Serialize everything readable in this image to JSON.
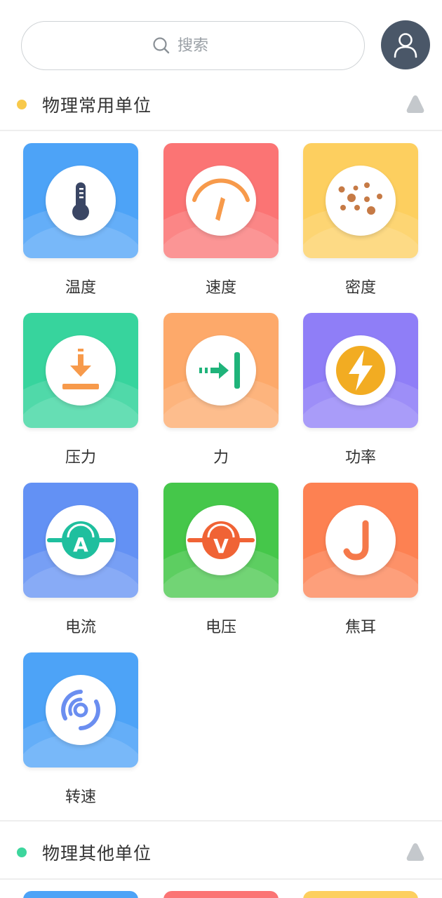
{
  "search": {
    "placeholder": "搜索"
  },
  "sections": [
    {
      "title": "物理常用单位",
      "dot_color": "#f8c94b",
      "items": [
        {
          "label": "温度",
          "icon": "thermometer-icon",
          "color": "#4da3f7"
        },
        {
          "label": "速度",
          "icon": "speedometer-icon",
          "color": "#fb7474"
        },
        {
          "label": "密度",
          "icon": "density-dots-icon",
          "color": "#fdcf5f"
        },
        {
          "label": "压力",
          "icon": "pressure-download-icon",
          "color": "#37d49d"
        },
        {
          "label": "力",
          "icon": "force-arrow-icon",
          "color": "#fda96a"
        },
        {
          "label": "功率",
          "icon": "lightning-icon",
          "color": "#8f7ef7"
        },
        {
          "label": "电流",
          "icon": "ammeter-icon",
          "color": "#6391f4"
        },
        {
          "label": "电压",
          "icon": "voltmeter-icon",
          "color": "#45c74a"
        },
        {
          "label": "焦耳",
          "icon": "joule-icon",
          "color": "#fd8152"
        },
        {
          "label": "转速",
          "icon": "rotation-icon",
          "color": "#4da3f7"
        }
      ]
    },
    {
      "title": "物理其他单位",
      "dot_color": "#3dd69d",
      "items_preview_colors": [
        "#4da3f7",
        "#fb7474",
        "#fdcf5f"
      ]
    }
  ],
  "colors": {
    "avatar_bg": "#4a5768",
    "toggle": "#c4c8cc",
    "text": "#333333",
    "placeholder": "#9aa0a6"
  }
}
